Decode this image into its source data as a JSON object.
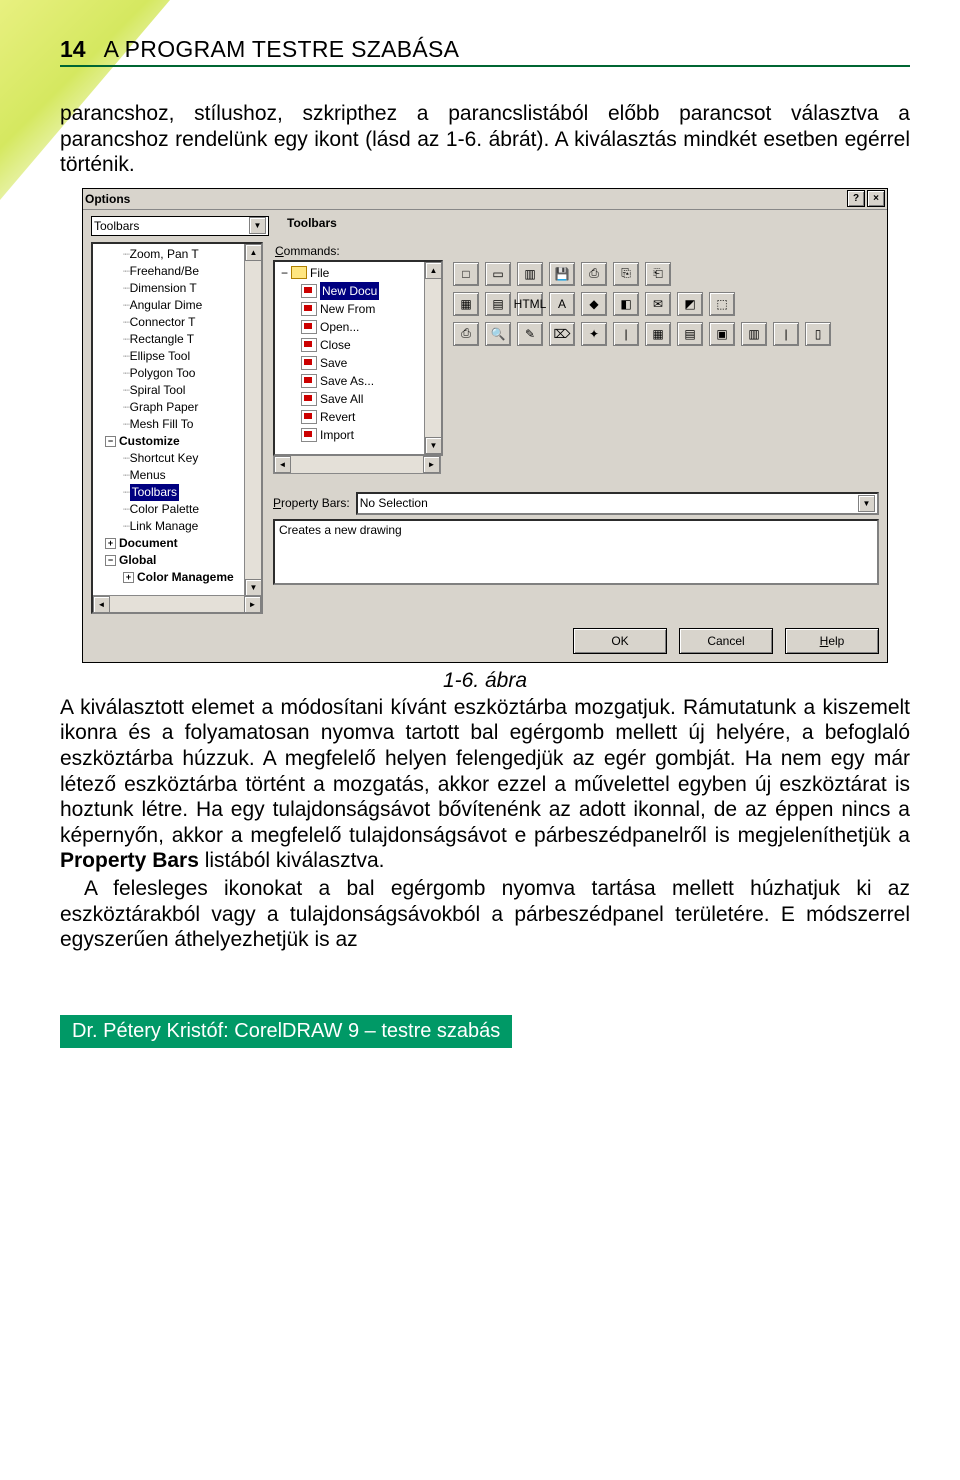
{
  "header": {
    "page_number": "14",
    "chapter_title": "A PROGRAM TESTRE SZABÁSA"
  },
  "para1": "parancshoz, stílushoz, szkripthez a parancslistából előbb parancsot választva a parancshoz rendelünk egy ikont (lásd az 1-6. ábrát). A kiválasztás mindkét esetben egérrel történik.",
  "figure_caption": "1-6. ábra",
  "para2_a": "A kiválasztott elemet a módosítani kívánt eszköztárba mozgatjuk. Rámutatunk a kiszemelt ikonra és a folyamatosan nyomva tartott bal egérgomb mellett új helyére, a befoglaló eszköztárba húzzuk. A megfelelő helyen felengedjük az egér gombját. Ha nem egy már létező eszköztárba történt a mozgatás, akkor ezzel a művelettel egyben új eszköztárat is hoztunk létre. Ha egy tulajdonságsávot bővítenénk az adott ikonnal, de az éppen nincs a képernyőn, akkor a megfelelő tulajdonságsávot e párbeszédpanelről is megjeleníthetjük a ",
  "para2_bold": "Property Bars",
  "para2_b": " listából kiválasztva.",
  "para3": "A felesleges ikonokat a bal egérgomb nyomva tartása mellett húzhatjuk ki az eszköztárakból vagy a tulajdonságsávokból a párbeszédpanel területére. E módszerrel egyszerűen áthelyezhetjük is az",
  "footer": "Dr. Pétery Kristóf: CorelDRAW 9 – testre szabás",
  "dialog": {
    "title": "Options",
    "top_combo": "Toolbars",
    "panel_title": "Toolbars",
    "left_tree": [
      {
        "indent": 1,
        "text": "Zoom, Pan T",
        "box": ""
      },
      {
        "indent": 1,
        "text": "Freehand/Be",
        "box": ""
      },
      {
        "indent": 1,
        "text": "Dimension T",
        "box": ""
      },
      {
        "indent": 1,
        "text": "Angular Dime",
        "box": ""
      },
      {
        "indent": 1,
        "text": "Connector T",
        "box": ""
      },
      {
        "indent": 1,
        "text": "Rectangle T",
        "box": ""
      },
      {
        "indent": 1,
        "text": "Ellipse Tool",
        "box": ""
      },
      {
        "indent": 1,
        "text": "Polygon Too",
        "box": ""
      },
      {
        "indent": 1,
        "text": "Spiral Tool",
        "box": ""
      },
      {
        "indent": 1,
        "text": "Graph Paper",
        "box": ""
      },
      {
        "indent": 1,
        "text": "Mesh Fill To",
        "box": ""
      },
      {
        "indent": 0,
        "text": "Customize",
        "box": "−"
      },
      {
        "indent": 1,
        "text": "Shortcut Key",
        "box": ""
      },
      {
        "indent": 1,
        "text": "Menus",
        "box": ""
      },
      {
        "indent": 1,
        "text": "Toolbars",
        "box": "",
        "selected": true
      },
      {
        "indent": 1,
        "text": "Color Palette",
        "box": ""
      },
      {
        "indent": 1,
        "text": "Link Manage",
        "box": ""
      },
      {
        "indent": 0,
        "text": "Document",
        "box": "+"
      },
      {
        "indent": 0,
        "text": "Global",
        "box": "−"
      },
      {
        "indent": 1,
        "text": "Color Manageme",
        "box": "+"
      }
    ],
    "commands_label": "Commands:",
    "cmd_tree": [
      {
        "text": "File",
        "folder": true,
        "box": "−"
      },
      {
        "text": "New Docu",
        "selected": true
      },
      {
        "text": "New From"
      },
      {
        "text": "Open..."
      },
      {
        "text": "Close"
      },
      {
        "text": "Save"
      },
      {
        "text": "Save As..."
      },
      {
        "text": "Save All"
      },
      {
        "text": "Revert"
      },
      {
        "text": "Import"
      }
    ],
    "icons_row1": [
      "□",
      "▭",
      "▥",
      "💾",
      "⎙",
      "⎘",
      "⎗"
    ],
    "icons_row2": [
      "▦",
      "▤",
      "HTML",
      "A",
      "◆",
      "◧",
      "✉",
      "◩",
      "⬚"
    ],
    "icons_row3": [
      "⎙",
      "🔍",
      "✎",
      "⌦",
      "✦",
      "|",
      "▦",
      "▤",
      "▣",
      "▥",
      "|",
      "▯"
    ],
    "property_bars_label": "Property Bars:",
    "property_bars_value": "No Selection",
    "description": "Creates a new drawing",
    "buttons": {
      "ok": "OK",
      "cancel": "Cancel",
      "help": "Help"
    }
  }
}
